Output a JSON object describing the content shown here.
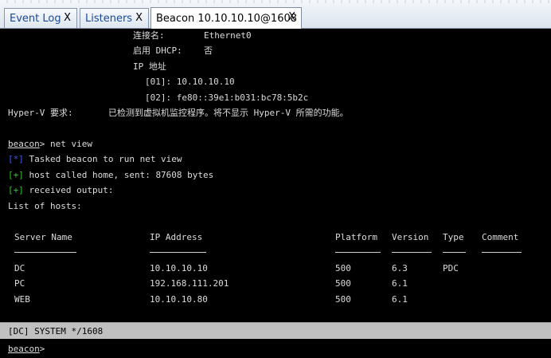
{
  "tabs": [
    {
      "label": "Event Log",
      "close": "X"
    },
    {
      "label": "Listeners",
      "close": "X"
    },
    {
      "label": "Beacon 10.10.10.10@1608",
      "close": "X"
    }
  ],
  "ipconfig": {
    "conn_label": "连接名:",
    "conn_value": "Ethernet0",
    "dhcp_label": "启用 DHCP:",
    "dhcp_value": "否",
    "ip_label": "IP 地址",
    "ip1": "[01]: 10.10.10.10",
    "ip2": "[02]: fe80::39e1:b031:bc78:5b2c",
    "hyperv_label": "Hyper-V 要求:",
    "hyperv_value": "已检测到虚拟机监控程序。将不显示 Hyper-V 所需的功能。"
  },
  "command": {
    "prompt": "beacon",
    "sep": "> ",
    "text": "net view"
  },
  "output": [
    {
      "tag": "[*]",
      "tag_color": "blue",
      "text": " Tasked beacon to run net view"
    },
    {
      "tag": "[+]",
      "tag_color": "green",
      "text": " host called home, sent: 87608 bytes"
    },
    {
      "tag": "[+]",
      "tag_color": "green",
      "text": " received output:"
    }
  ],
  "list_title": "List of hosts:",
  "table": {
    "headers": [
      "Server Name",
      "IP Address",
      "Platform",
      "Version",
      "Type",
      "Comment"
    ],
    "rows": [
      [
        "DC",
        "10.10.10.10",
        "500",
        "6.3",
        "PDC",
        ""
      ],
      [
        "PC",
        "192.168.111.201",
        "500",
        "6.1",
        "",
        ""
      ],
      [
        "WEB",
        "10.10.10.80",
        "500",
        "6.1",
        "",
        ""
      ]
    ]
  },
  "status": "[DC] SYSTEM */1608",
  "input": {
    "prompt": "beacon",
    "sep": ">",
    "value": ""
  }
}
